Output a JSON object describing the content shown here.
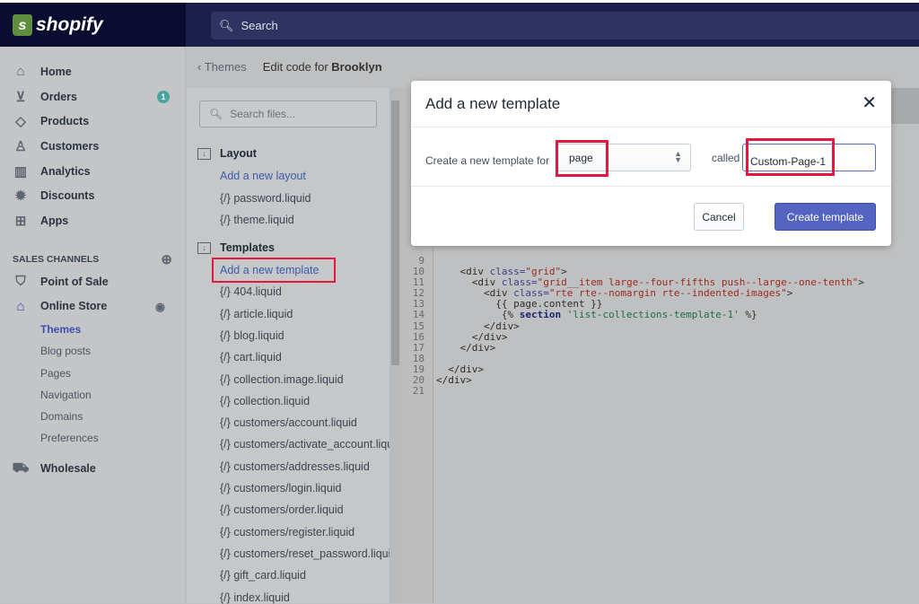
{
  "brand": {
    "name": "shopify",
    "logo_letter": "s",
    "color": "#5e8e3e"
  },
  "topbar": {
    "search_placeholder": "Search"
  },
  "sidebar": {
    "items": [
      {
        "label": "Home",
        "icon": "home-icon"
      },
      {
        "label": "Orders",
        "icon": "orders-icon",
        "badge": "1"
      },
      {
        "label": "Products",
        "icon": "tag-icon"
      },
      {
        "label": "Customers",
        "icon": "person-icon"
      },
      {
        "label": "Analytics",
        "icon": "bar-chart-icon"
      },
      {
        "label": "Discounts",
        "icon": "discount-icon"
      },
      {
        "label": "Apps",
        "icon": "apps-icon"
      }
    ],
    "sales_channels_label": "SALES CHANNELS",
    "channels": [
      {
        "label": "Point of Sale"
      },
      {
        "label": "Online Store"
      }
    ],
    "online_store_sub": [
      "Themes",
      "Blog posts",
      "Pages",
      "Navigation",
      "Domains",
      "Preferences"
    ],
    "wholesale": "Wholesale"
  },
  "breadcrumb": {
    "back": "Themes",
    "title_prefix": "Edit code for ",
    "theme": "Brooklyn"
  },
  "files": {
    "search_placeholder": "Search files...",
    "layout": {
      "title": "Layout",
      "add": "Add a new layout",
      "items": [
        "password.liquid",
        "theme.liquid"
      ]
    },
    "templates": {
      "title": "Templates",
      "add": "Add a new template",
      "items": [
        "404.liquid",
        "article.liquid",
        "blog.liquid",
        "cart.liquid",
        "collection.image.liquid",
        "collection.liquid",
        "customers/account.liquid",
        "customers/activate_account.liquid",
        "customers/addresses.liquid",
        "customers/login.liquid",
        "customers/order.liquid",
        "customers/register.liquid",
        "customers/reset_password.liquid",
        "gift_card.liquid",
        "index.liquid"
      ]
    },
    "file_icon": "{/}"
  },
  "code": {
    "lines": [
      {
        "n": "9",
        "t": ""
      },
      {
        "n": "10",
        "fold": true,
        "t": "    <div class=\"grid\">"
      },
      {
        "n": "11",
        "fold": true,
        "t": "      <div class=\"grid__item large--four-fifths push--large--one-tenth\">"
      },
      {
        "n": "12",
        "fold": true,
        "t": "        <div class=\"rte rte--nomargin rte--indented-images\">"
      },
      {
        "n": "13",
        "t": "          {{ page.content }}"
      },
      {
        "n": "14",
        "t": "           {% section 'list-collections-template-1' %}"
      },
      {
        "n": "15",
        "t": "        </div>"
      },
      {
        "n": "16",
        "t": "      </div>"
      },
      {
        "n": "17",
        "t": "    </div>"
      },
      {
        "n": "18",
        "t": ""
      },
      {
        "n": "19",
        "t": "  </div>"
      },
      {
        "n": "20",
        "t": "</div>"
      },
      {
        "n": "21",
        "t": ""
      }
    ]
  },
  "modal": {
    "title": "Add a new template",
    "label": "Create a new template for",
    "select_value": "page",
    "called": "called",
    "name_value": "Custom-Page-1",
    "cancel": "Cancel",
    "create": "Create template",
    "primary_color": "#5563c1",
    "highlight_color": "#e4173e"
  }
}
